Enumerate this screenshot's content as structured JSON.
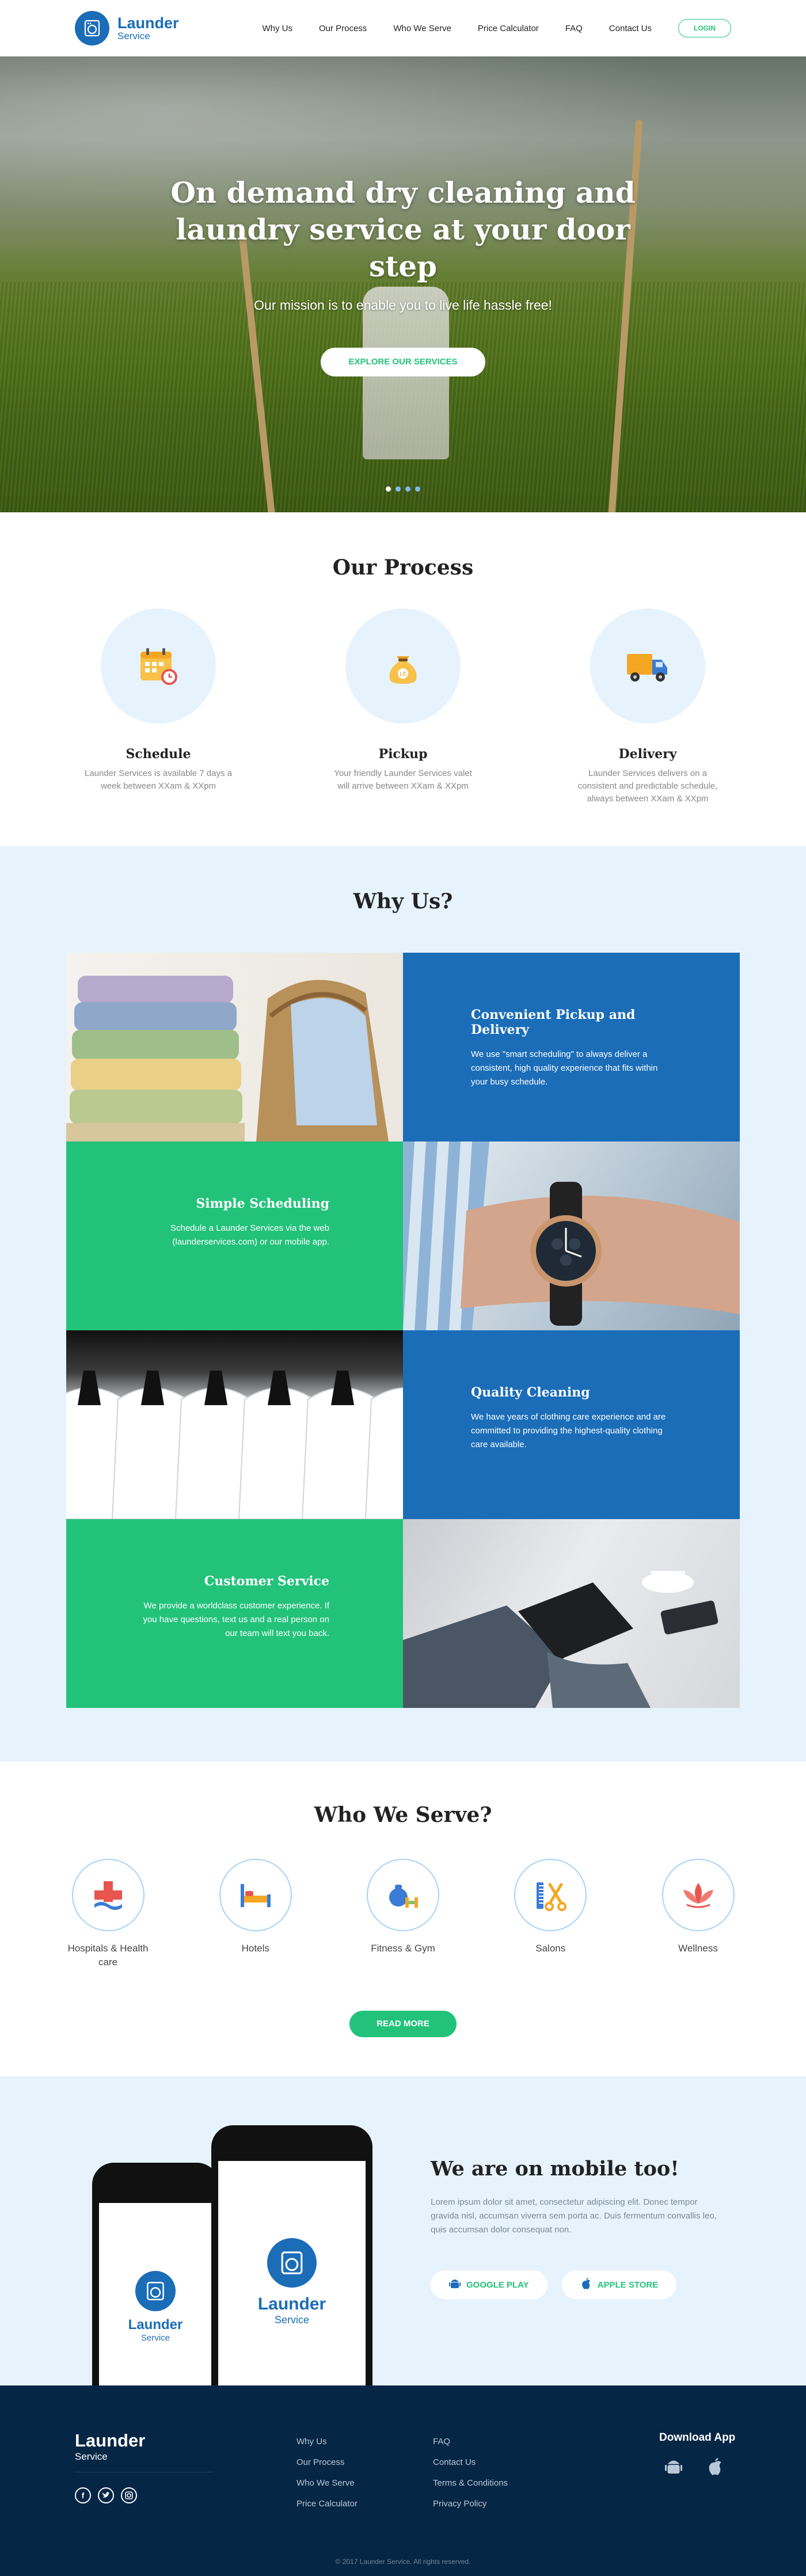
{
  "header": {
    "logo_line1": "Launder",
    "logo_line2": "Service",
    "nav": [
      "Why Us",
      "Our Process",
      "Who We Serve",
      "Price Calculator",
      "FAQ",
      "Contact Us"
    ],
    "login": "LOGIN"
  },
  "hero": {
    "title": "On demand dry cleaning and laundry service at your door step",
    "subtitle": "Our mission is to enable you to live life hassle free!",
    "button": "EXPLORE OUR SERVICES",
    "slides": 4,
    "active_slide": 1
  },
  "process": {
    "title": "Our Process",
    "items": [
      {
        "icon": "calendar-icon",
        "title": "Schedule",
        "desc": "Launder Services is available 7 days a week between XXam & XXpm"
      },
      {
        "icon": "money-bag-icon",
        "title": "Pickup",
        "desc": "Your friendly Launder Services valet will arrive between XXam & XXpm"
      },
      {
        "icon": "delivery-truck-icon",
        "title": "Delivery",
        "desc": "Launder Services delivers on a consistent and predictable schedule, always between XXam & XXpm"
      }
    ]
  },
  "why": {
    "title": "Why Us?",
    "items": [
      {
        "title": "Convenient Pickup and Delivery",
        "desc": "We use \"smart scheduling\" to always deliver a consistent, high quality experience that fits within your busy schedule."
      },
      {
        "title": "Simple Scheduling",
        "desc": "Schedule a Launder Services via the web (launderservices.com) or our mobile app."
      },
      {
        "title": "Quality Cleaning",
        "desc": "We have years of clothing care experience and are committed to providing the highest-quality clothing care available."
      },
      {
        "title": "Customer Service",
        "desc": "We provide a worldclass customer experience. If you have questions, text us and a real person on our team will text you back."
      }
    ]
  },
  "serve": {
    "title": "Who We Serve?",
    "items": [
      {
        "icon": "hospital-cross-icon",
        "label": "Hospitals & Health care"
      },
      {
        "icon": "hotel-bed-icon",
        "label": "Hotels"
      },
      {
        "icon": "fitness-icon",
        "label": "Fitness & Gym"
      },
      {
        "icon": "salon-comb-scissors-icon",
        "label": "Salons"
      },
      {
        "icon": "lotus-icon",
        "label": "Wellness"
      }
    ],
    "button": "READ MORE"
  },
  "mobile": {
    "title": "We are on mobile too!",
    "desc": "Lorem ipsum dolor sit amet, consectetur adipiscing elit. Donec tempor gravida nisl, accumsan viverra sem porta ac. Duis fermentum convallis leo, quis accumsan dolor consequat non.",
    "google_play": "GOOGLE PLAY",
    "apple_store": "APPLE STORE",
    "app_logo_line1": "Launder",
    "app_logo_line2": "Service"
  },
  "footer": {
    "logo_line1": "Launder",
    "logo_line2": "Service",
    "col1": [
      "Why Us",
      "Our Process",
      "Who We Serve",
      "Price Calculator"
    ],
    "col2": [
      "FAQ",
      "Contact Us",
      "Terms & Conditions",
      "Privacy Policy"
    ],
    "download": "Download App",
    "copyright": "© 2017 Launder Service. All rights reserved."
  },
  "colors": {
    "primary_blue": "#1b6db8",
    "accent_green": "#23c27a",
    "light_bg": "#e6f3fd",
    "footer_bg": "#062646"
  }
}
